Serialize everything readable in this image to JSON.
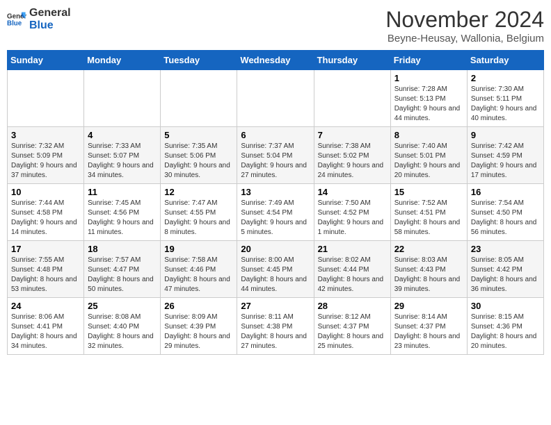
{
  "logo": {
    "general": "General",
    "blue": "Blue"
  },
  "header": {
    "month_year": "November 2024",
    "location": "Beyne-Heusay, Wallonia, Belgium"
  },
  "weekdays": [
    "Sunday",
    "Monday",
    "Tuesday",
    "Wednesday",
    "Thursday",
    "Friday",
    "Saturday"
  ],
  "weeks": [
    [
      {
        "day": "",
        "info": ""
      },
      {
        "day": "",
        "info": ""
      },
      {
        "day": "",
        "info": ""
      },
      {
        "day": "",
        "info": ""
      },
      {
        "day": "",
        "info": ""
      },
      {
        "day": "1",
        "info": "Sunrise: 7:28 AM\nSunset: 5:13 PM\nDaylight: 9 hours and 44 minutes."
      },
      {
        "day": "2",
        "info": "Sunrise: 7:30 AM\nSunset: 5:11 PM\nDaylight: 9 hours and 40 minutes."
      }
    ],
    [
      {
        "day": "3",
        "info": "Sunrise: 7:32 AM\nSunset: 5:09 PM\nDaylight: 9 hours and 37 minutes."
      },
      {
        "day": "4",
        "info": "Sunrise: 7:33 AM\nSunset: 5:07 PM\nDaylight: 9 hours and 34 minutes."
      },
      {
        "day": "5",
        "info": "Sunrise: 7:35 AM\nSunset: 5:06 PM\nDaylight: 9 hours and 30 minutes."
      },
      {
        "day": "6",
        "info": "Sunrise: 7:37 AM\nSunset: 5:04 PM\nDaylight: 9 hours and 27 minutes."
      },
      {
        "day": "7",
        "info": "Sunrise: 7:38 AM\nSunset: 5:02 PM\nDaylight: 9 hours and 24 minutes."
      },
      {
        "day": "8",
        "info": "Sunrise: 7:40 AM\nSunset: 5:01 PM\nDaylight: 9 hours and 20 minutes."
      },
      {
        "day": "9",
        "info": "Sunrise: 7:42 AM\nSunset: 4:59 PM\nDaylight: 9 hours and 17 minutes."
      }
    ],
    [
      {
        "day": "10",
        "info": "Sunrise: 7:44 AM\nSunset: 4:58 PM\nDaylight: 9 hours and 14 minutes."
      },
      {
        "day": "11",
        "info": "Sunrise: 7:45 AM\nSunset: 4:56 PM\nDaylight: 9 hours and 11 minutes."
      },
      {
        "day": "12",
        "info": "Sunrise: 7:47 AM\nSunset: 4:55 PM\nDaylight: 9 hours and 8 minutes."
      },
      {
        "day": "13",
        "info": "Sunrise: 7:49 AM\nSunset: 4:54 PM\nDaylight: 9 hours and 5 minutes."
      },
      {
        "day": "14",
        "info": "Sunrise: 7:50 AM\nSunset: 4:52 PM\nDaylight: 9 hours and 1 minute."
      },
      {
        "day": "15",
        "info": "Sunrise: 7:52 AM\nSunset: 4:51 PM\nDaylight: 8 hours and 58 minutes."
      },
      {
        "day": "16",
        "info": "Sunrise: 7:54 AM\nSunset: 4:50 PM\nDaylight: 8 hours and 56 minutes."
      }
    ],
    [
      {
        "day": "17",
        "info": "Sunrise: 7:55 AM\nSunset: 4:48 PM\nDaylight: 8 hours and 53 minutes."
      },
      {
        "day": "18",
        "info": "Sunrise: 7:57 AM\nSunset: 4:47 PM\nDaylight: 8 hours and 50 minutes."
      },
      {
        "day": "19",
        "info": "Sunrise: 7:58 AM\nSunset: 4:46 PM\nDaylight: 8 hours and 47 minutes."
      },
      {
        "day": "20",
        "info": "Sunrise: 8:00 AM\nSunset: 4:45 PM\nDaylight: 8 hours and 44 minutes."
      },
      {
        "day": "21",
        "info": "Sunrise: 8:02 AM\nSunset: 4:44 PM\nDaylight: 8 hours and 42 minutes."
      },
      {
        "day": "22",
        "info": "Sunrise: 8:03 AM\nSunset: 4:43 PM\nDaylight: 8 hours and 39 minutes."
      },
      {
        "day": "23",
        "info": "Sunrise: 8:05 AM\nSunset: 4:42 PM\nDaylight: 8 hours and 36 minutes."
      }
    ],
    [
      {
        "day": "24",
        "info": "Sunrise: 8:06 AM\nSunset: 4:41 PM\nDaylight: 8 hours and 34 minutes."
      },
      {
        "day": "25",
        "info": "Sunrise: 8:08 AM\nSunset: 4:40 PM\nDaylight: 8 hours and 32 minutes."
      },
      {
        "day": "26",
        "info": "Sunrise: 8:09 AM\nSunset: 4:39 PM\nDaylight: 8 hours and 29 minutes."
      },
      {
        "day": "27",
        "info": "Sunrise: 8:11 AM\nSunset: 4:38 PM\nDaylight: 8 hours and 27 minutes."
      },
      {
        "day": "28",
        "info": "Sunrise: 8:12 AM\nSunset: 4:37 PM\nDaylight: 8 hours and 25 minutes."
      },
      {
        "day": "29",
        "info": "Sunrise: 8:14 AM\nSunset: 4:37 PM\nDaylight: 8 hours and 23 minutes."
      },
      {
        "day": "30",
        "info": "Sunrise: 8:15 AM\nSunset: 4:36 PM\nDaylight: 8 hours and 20 minutes."
      }
    ]
  ]
}
